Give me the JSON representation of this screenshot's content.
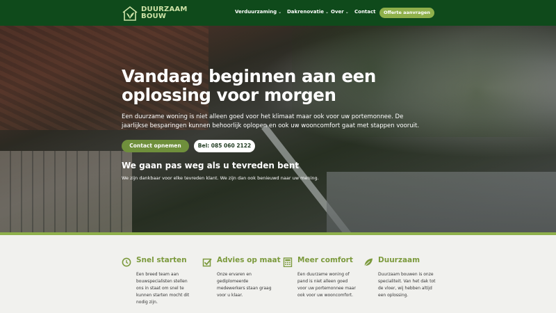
{
  "brand": {
    "name_line1": "DUURZAAM",
    "name_line2": "BOUW",
    "accent": "#8fb04b",
    "header_bg": "#0f4a1b"
  },
  "nav": {
    "items": [
      {
        "label": "Verduurzaming",
        "dropdown": true
      },
      {
        "label": "Dakrenovatie",
        "dropdown": true
      },
      {
        "label": "Over",
        "dropdown": true
      },
      {
        "label": "Contact",
        "dropdown": false
      }
    ],
    "cta": "Offerte aanvragen"
  },
  "hero": {
    "title": "Vandaag beginnen aan een oplossing voor morgen",
    "text": "Een duurzame woning is niet alleen goed voor het klimaat maar ook voor uw portemonnee. De jaarlijkse besparingen kunnen behoorlijk oplopen en ook uw wooncomfort gaat met stappen vooruit.",
    "btn_primary": "Contact opnemen",
    "btn_secondary": "Bel: 085 060 2122",
    "subtitle": "We gaan pas weg als u tevreden bent",
    "subtext": "We zijn dankbaar voor elke tevreden klant. We zijn dan ook benieuwd naar uw mening."
  },
  "features": [
    {
      "icon": "clock-icon",
      "title": "Snel starten",
      "text": "Een breed team aan bouwspecialisten stellen ons in staat om snel te kunnen starten mocht dit nodig zijn."
    },
    {
      "icon": "checkbox-icon",
      "title": "Advies op maat",
      "text": "Onze ervaren en gediplomeerde medewerkers staan graag voor u klaar."
    },
    {
      "icon": "calculator-icon",
      "title": "Meer comfort",
      "text": "Een duurzame woning of pand is niet alleen goed voor uw portemonnee maar ook voor uw wooncomfort."
    },
    {
      "icon": "leaf-icon",
      "title": "Duurzaam",
      "text": "Duurzaam bouwen is onze specialiteit. Van het dak tot de vloer, wij hebben altijd een oplossing."
    }
  ]
}
